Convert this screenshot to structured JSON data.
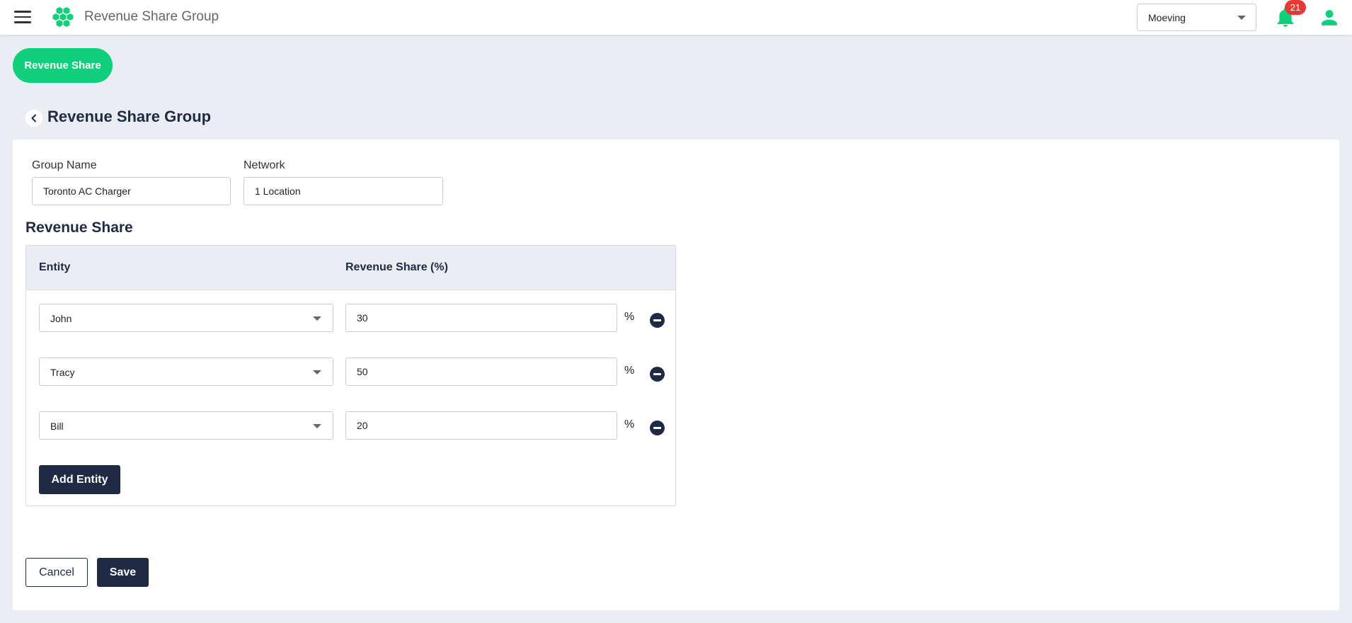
{
  "header": {
    "app_title": "Revenue Share Group",
    "org_selector": {
      "value": "Moeving"
    },
    "notifications": {
      "count": "21"
    },
    "accent_color": "#0fce7c"
  },
  "tab_pill": {
    "label": "Revenue Share"
  },
  "page": {
    "title": "Revenue Share Group"
  },
  "form": {
    "group_name": {
      "label": "Group Name",
      "value": "Toronto AC Charger"
    },
    "network": {
      "label": "Network",
      "value": "1 Location"
    },
    "revenue_share": {
      "section_title": "Revenue Share",
      "columns": {
        "entity": "Entity",
        "share": "Revenue Share (%)"
      },
      "rows": [
        {
          "entity": "John",
          "share": "30",
          "unit": "%"
        },
        {
          "entity": "Tracy",
          "share": "50",
          "unit": "%"
        },
        {
          "entity": "Bill",
          "share": "20",
          "unit": "%"
        }
      ],
      "add_label": "Add Entity"
    },
    "actions": {
      "cancel_label": "Cancel",
      "save_label": "Save"
    }
  },
  "icons": {
    "menu": "hamburger-menu-icon",
    "logo": "hexagon-cluster-logo",
    "notifications": "bell-icon",
    "user": "user-icon",
    "back": "chevron-left-icon",
    "remove": "minus-circle-icon",
    "dropdown": "chevron-down-icon"
  }
}
